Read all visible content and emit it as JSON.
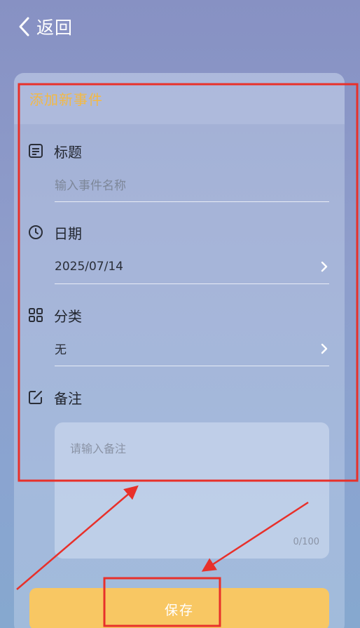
{
  "header": {
    "back_label": "返回"
  },
  "card": {
    "title": "添加新事件",
    "title_section": {
      "label": "标题",
      "icon": "document-lines-icon",
      "placeholder": "输入事件名称"
    },
    "date_section": {
      "label": "日期",
      "icon": "clock-icon",
      "value": "2025/07/14"
    },
    "category_section": {
      "label": "分类",
      "icon": "grid-icon",
      "value": "无"
    },
    "notes_section": {
      "label": "备注",
      "icon": "edit-icon",
      "placeholder": "请输入备注",
      "counter": "0/100"
    }
  },
  "footer": {
    "save_label": "保存"
  },
  "colors": {
    "accent": "#f3b945",
    "save_button": "#f8c763",
    "annotation_red": "#e8302a"
  }
}
